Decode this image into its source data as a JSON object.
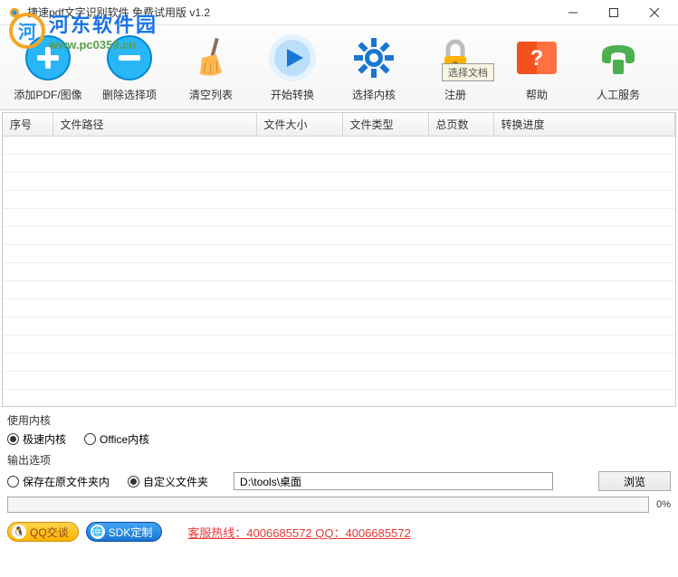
{
  "window": {
    "title": "捷速pdf文字识别软件 免费试用版 v1.2"
  },
  "toolbar": [
    {
      "id": "add",
      "label": "添加PDF/图像"
    },
    {
      "id": "delete",
      "label": "删除选择项"
    },
    {
      "id": "clear",
      "label": "清空列表"
    },
    {
      "id": "start",
      "label": "开始转换"
    },
    {
      "id": "kernel",
      "label": "选择内核"
    },
    {
      "id": "register",
      "label": "注册",
      "tooltip": "选择文档"
    },
    {
      "id": "help",
      "label": "帮助"
    },
    {
      "id": "support",
      "label": "人工服务"
    }
  ],
  "table": {
    "columns": [
      "序号",
      "文件路径",
      "文件大小",
      "文件类型",
      "总页数",
      "转换进度"
    ]
  },
  "kernel_section": {
    "title": "使用内核",
    "opt_fast": "极速内核",
    "opt_office": "Office内核"
  },
  "output_section": {
    "title": "输出选项",
    "opt_same": "保存在原文件夹内",
    "opt_custom": "自定义文件夹",
    "path": "D:\\tools\\桌面",
    "browse": "浏览"
  },
  "progress": {
    "pct": "0%"
  },
  "footer": {
    "qq": "QQ交谈",
    "sdk": "SDK定制",
    "hotline": "客服热线：4006685572 QQ：4006685572"
  },
  "watermark": {
    "cn": "河东软件园",
    "url": "www.pc0359.cn"
  }
}
